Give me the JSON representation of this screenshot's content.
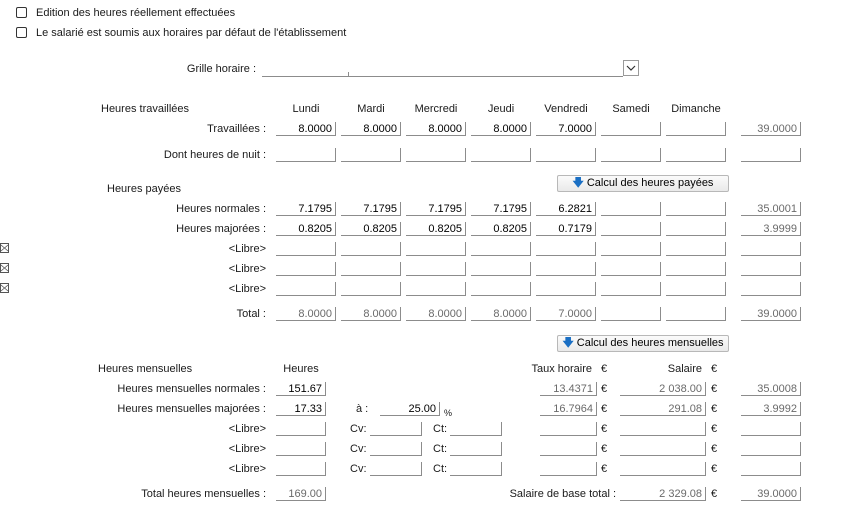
{
  "checkboxes": {
    "edition": {
      "label": "Edition des heures réellement effectuées",
      "checked": false
    },
    "soumis": {
      "label": "Le salarié est soumis aux horaires par défaut de l'établissement",
      "checked": false
    }
  },
  "grille": {
    "label": "Grille horaire :",
    "value": ""
  },
  "days": [
    "Lundi",
    "Mardi",
    "Mercredi",
    "Jeudi",
    "Vendredi",
    "Samedi",
    "Dimanche"
  ],
  "travaillees": {
    "section": "Heures travaillées",
    "rows": [
      {
        "label": "Travaillées :",
        "values": [
          "8.0000",
          "8.0000",
          "8.0000",
          "8.0000",
          "7.0000",
          "",
          ""
        ],
        "total": "39.0000"
      },
      {
        "label": "Dont heures de nuit :",
        "values": [
          "",
          "",
          "",
          "",
          "",
          "",
          ""
        ],
        "total": ""
      }
    ]
  },
  "payees": {
    "section": "Heures payées",
    "button": "Calcul des heures payées",
    "rows": [
      {
        "label": "Heures normales :",
        "values": [
          "7.1795",
          "7.1795",
          "7.1795",
          "7.1795",
          "6.2821",
          "",
          ""
        ],
        "total": "35.0001"
      },
      {
        "label": "Heures majorées :",
        "values": [
          "0.8205",
          "0.8205",
          "0.8205",
          "0.8205",
          "0.7179",
          "",
          ""
        ],
        "total": "3.9999"
      },
      {
        "label": "<Libre>",
        "values": [
          "",
          "",
          "",
          "",
          "",
          "",
          ""
        ],
        "total": ""
      },
      {
        "label": "<Libre>",
        "values": [
          "",
          "",
          "",
          "",
          "",
          "",
          ""
        ],
        "total": ""
      },
      {
        "label": "<Libre>",
        "values": [
          "",
          "",
          "",
          "",
          "",
          "",
          ""
        ],
        "total": ""
      }
    ],
    "total": {
      "label": "Total :",
      "values": [
        "8.0000",
        "8.0000",
        "8.0000",
        "8.0000",
        "7.0000",
        "",
        ""
      ],
      "total": "39.0000"
    }
  },
  "mensuelles": {
    "section": "Heures mensuelles",
    "button": "Calcul des heures mensuelles",
    "col_heures": "Heures",
    "col_taux": "Taux horaire",
    "col_salaire": "Salaire",
    "euro": "€",
    "normales": {
      "label": "Heures mensuelles normales :",
      "heures": "151.67",
      "taux": "13.4371",
      "salaire": "2 038.00",
      "total": "35.0008"
    },
    "majorees": {
      "label": "Heures mensuelles majorées :",
      "heures": "17.33",
      "a_label": "à :",
      "pct": "25.00",
      "pct_unit": "%",
      "taux": "16.7964",
      "salaire": "291.08",
      "total": "3.9992"
    },
    "libres": [
      {
        "label": "<Libre>",
        "cv": "Cv:",
        "ct": "Ct:"
      },
      {
        "label": "<Libre>",
        "cv": "Cv:",
        "ct": "Ct:"
      },
      {
        "label": "<Libre>",
        "cv": "Cv:",
        "ct": "Ct:"
      }
    ],
    "total_label": "Total heures mensuelles :",
    "total_heures": "169.00",
    "salaire_base_label": "Salaire de base total :",
    "salaire_base": "2 329.08",
    "salaire_total": "39.0000"
  }
}
